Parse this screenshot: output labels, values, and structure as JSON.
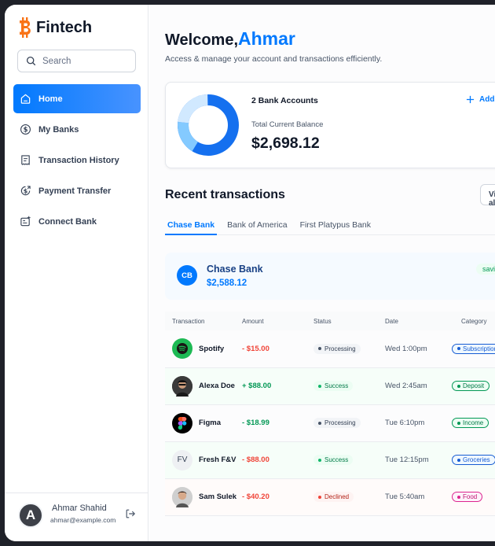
{
  "app": {
    "name": "Fintech"
  },
  "search": {
    "placeholder": "Search"
  },
  "sidebar": {
    "items": [
      {
        "label": "Home",
        "icon": "home-icon",
        "active": true
      },
      {
        "label": "My Banks",
        "icon": "dollar-circle-icon"
      },
      {
        "label": "Transaction History",
        "icon": "receipt-icon"
      },
      {
        "label": "Payment Transfer",
        "icon": "money-send-icon"
      },
      {
        "label": "Connect Bank",
        "icon": "connect-bank-icon"
      }
    ]
  },
  "user": {
    "initial": "A",
    "name": "Ahmar Shahid",
    "email": "ahmar@example.com"
  },
  "header": {
    "welcome": "Welcome,",
    "name": "Ahmar",
    "subtitle": "Access & manage your account and transactions efficiently."
  },
  "balance": {
    "accounts": "2 Bank Accounts",
    "label": "Total Current Balance",
    "amount": "$2,698.12",
    "add_label": "Add"
  },
  "recent": {
    "title": "Recent transactions",
    "view_all": "View all",
    "tabs": [
      "Chase Bank",
      "Bank of America",
      "First Platypus Bank"
    ]
  },
  "bank_card": {
    "initials": "CB",
    "name": "Chase Bank",
    "balance": "$2,588.12",
    "type": "savings"
  },
  "table": {
    "headers": [
      "Transaction",
      "Amount",
      "Status",
      "Date",
      "Category"
    ],
    "rows": [
      {
        "name": "Spotify",
        "amount": "- $15.00",
        "status": "Processing",
        "date": "Wed 1:00pm",
        "category": "Subscriptions"
      },
      {
        "name": "Alexa Doe",
        "amount": "+ $88.00",
        "status": "Success",
        "date": "Wed 2:45am",
        "category": "Deposit"
      },
      {
        "name": "Figma",
        "amount": "- $18.99",
        "status": "Processing",
        "date": "Tue 6:10pm",
        "category": "Income"
      },
      {
        "name": "Fresh F&V",
        "initials": "FV",
        "amount": "- $88.00",
        "status": "Success",
        "date": "Tue 12:15pm",
        "category": "Groceries"
      },
      {
        "name": "Sam Sulek",
        "amount": "- $40.20",
        "status": "Declined",
        "date": "Tue 5:40am",
        "category": "Food"
      }
    ]
  },
  "colors": {
    "accent": "#0179fe",
    "success": "#039855",
    "danger": "#f04438"
  }
}
